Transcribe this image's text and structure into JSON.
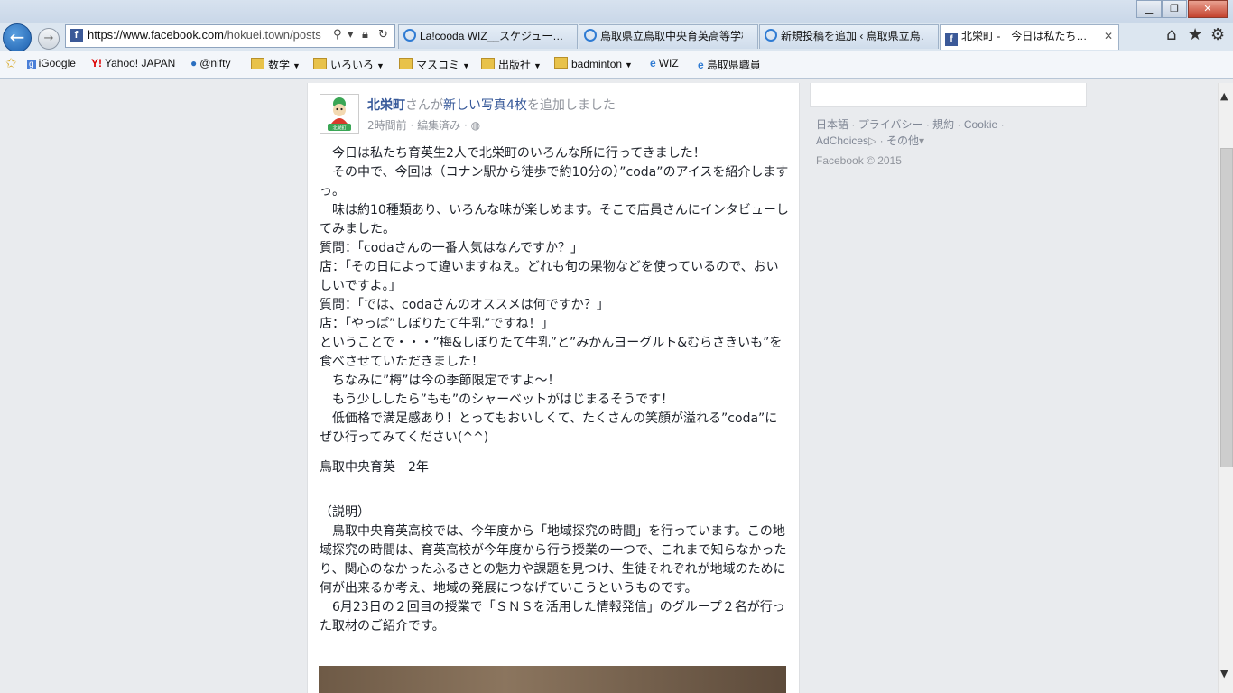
{
  "browser": {
    "address_host": "https://www.facebook.com",
    "address_path": "/hokuei.town/posts",
    "tabs": [
      {
        "title": "La!cooda WIZ__スケジュー…",
        "icon": "ie-icon"
      },
      {
        "title": "鳥取県立鳥取中央育英高等学校",
        "icon": "ie-icon"
      },
      {
        "title": "新規投稿を追加 ‹ 鳥取県立鳥…",
        "icon": "ie-icon"
      },
      {
        "title": "北栄町 -　今日は私たち…",
        "icon": "facebook-icon",
        "close": "✕"
      }
    ],
    "favorites": [
      {
        "label": "iGoogle",
        "type": "link"
      },
      {
        "label": "Yahoo! JAPAN",
        "type": "link"
      },
      {
        "label": "@nifty",
        "type": "link"
      },
      {
        "label": "数学",
        "type": "folder"
      },
      {
        "label": "いろいろ",
        "type": "folder"
      },
      {
        "label": "マスコミ",
        "type": "folder"
      },
      {
        "label": "出版社",
        "type": "folder"
      },
      {
        "label": "badminton",
        "type": "folder"
      },
      {
        "label": "WIZ",
        "type": "link"
      },
      {
        "label": "鳥取県職員",
        "type": "link"
      }
    ]
  },
  "post": {
    "page_name": "北栄町",
    "header_mid": "さんが",
    "header_link": "新しい写真4枚",
    "header_end": "を追加しました",
    "time": "2時間前",
    "sep": "·",
    "edited": "編集済み",
    "sep2": "·",
    "avatar_label": "北栄町",
    "body": [
      "　今日は私たち育英生2人で北栄町のいろんな所に行ってきました！",
      "　その中で、今回は（コナン駅から徒歩で約10分の）”coda”のアイスを紹介しますっ。",
      "　味は約10種類あり、いろんな味が楽しめます。そこで店員さんにインタビューしてみました。",
      "質問：「codaさんの一番人気はなんですか？」",
      "店：「その日によって違いますねえ。どれも旬の果物などを使っているので、おいしいですよ。」",
      "質問：「では、codaさんのオススメは何ですか？」",
      "店：「やっぱ”しぼりたて牛乳”ですね！」",
      "ということで・・・”梅&しぼりたて牛乳”と”みかんヨーグルト&むらさきいも”を食べさせていただきました！",
      "　ちなみに”梅”は今の季節限定ですよ～！",
      "　もう少ししたら”もも”のシャーベットがはじまるそうです！",
      "　低価格で満足感あり！とってもおいしくて、たくさんの笑顔が溢れる”coda”にぜひ行ってみてください(^^)"
    ],
    "author": "鳥取中央育英　2年",
    "explanation": [
      "（説明）",
      "　鳥取中央育英高校では、今年度から「地域探究の時間」を行っています。この地域探究の時間は、育英高校が今年度から行う授業の一つで、これまで知らなかったり、関心のなかったふるさとの魅力や課題を見つけ、生徒それぞれが地域のために何が出来るか考え、地域の発展につなげていこうというものです。",
      "　6月23日の２回目の授業で「ＳＮＳを活用した情報発信」のグループ２名が行った取材のご紹介です。"
    ]
  },
  "footer": {
    "links": [
      "日本語",
      "プライバシー",
      "規約",
      "Cookie",
      "AdChoices",
      "その他"
    ],
    "sep": "·",
    "copyright": "Facebook © 2015"
  }
}
